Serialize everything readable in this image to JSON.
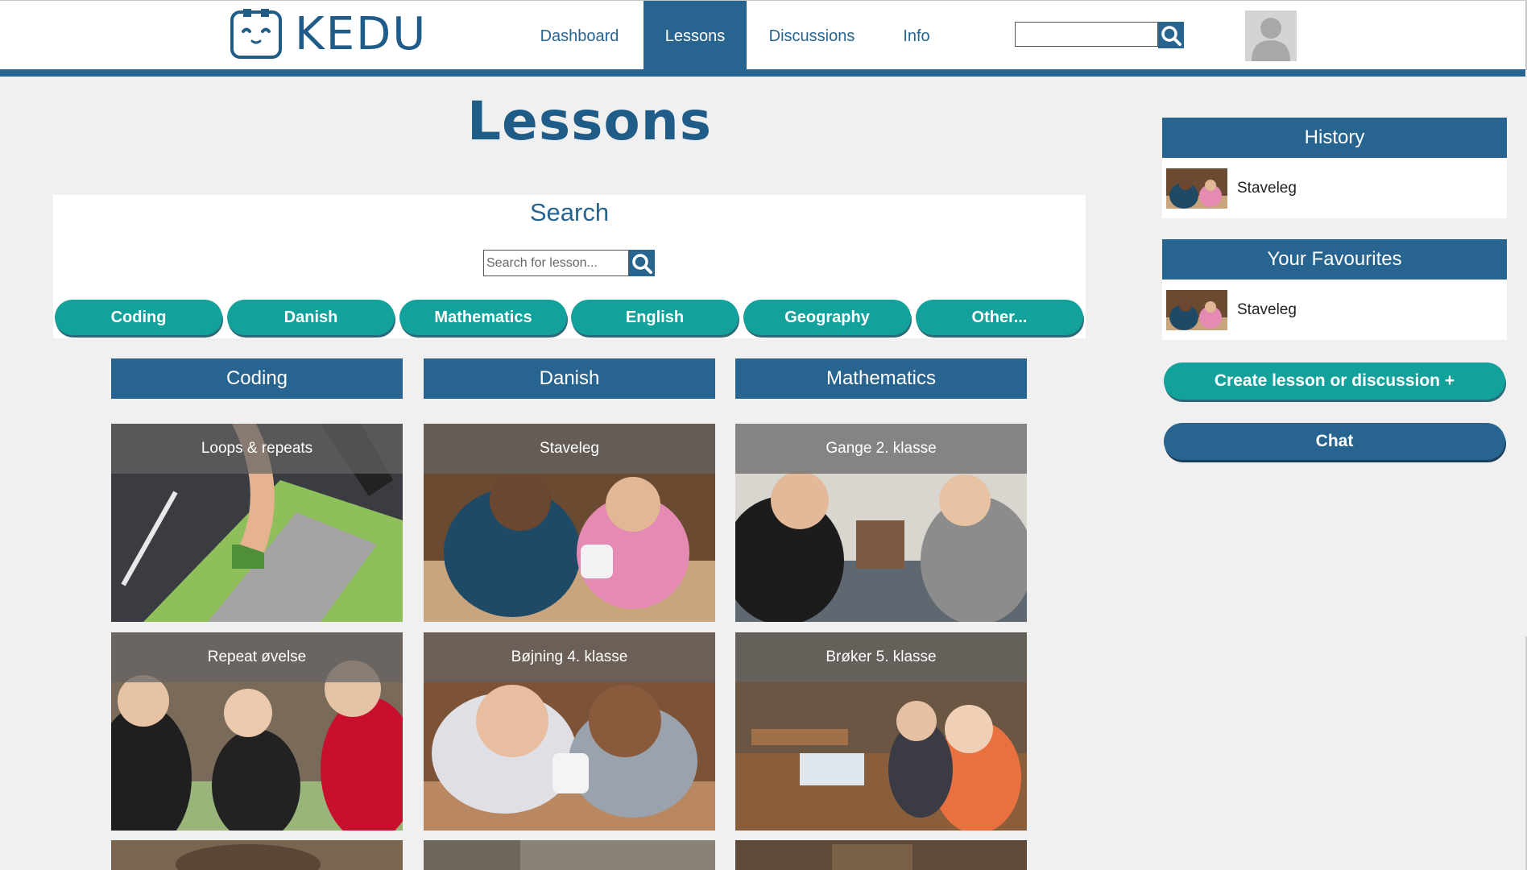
{
  "nav": {
    "logo_text": "KEDU",
    "items": [
      {
        "label": "Dashboard"
      },
      {
        "label": "Lessons",
        "active": true
      },
      {
        "label": "Discussions"
      },
      {
        "label": "Info"
      }
    ],
    "search_value": ""
  },
  "page": {
    "title": "Lessons"
  },
  "search": {
    "heading": "Search",
    "placeholder": "Search for lesson...",
    "value": "",
    "filters": [
      "Coding",
      "Danish",
      "Mathematics",
      "English",
      "Geography",
      "Other..."
    ]
  },
  "columns": [
    {
      "title": "Coding",
      "cards": [
        "Loops & repeats",
        "Repeat øvelse"
      ]
    },
    {
      "title": "Danish",
      "cards": [
        "Staveleg",
        "Bøjning 4. klasse"
      ]
    },
    {
      "title": "Mathematics",
      "cards": [
        "Gange 2. klasse",
        "Brøker 5. klasse"
      ]
    }
  ],
  "sidebar": {
    "history": {
      "title": "History",
      "items": [
        "Staveleg"
      ]
    },
    "favourites": {
      "title": "Your Favourites",
      "items": [
        "Staveleg"
      ]
    },
    "create_button": "Create lesson or discussion +",
    "chat_button": "Chat"
  },
  "colors": {
    "primary_blue": "#286490",
    "teal": "#13a19c",
    "background": "#f0f0f0"
  }
}
